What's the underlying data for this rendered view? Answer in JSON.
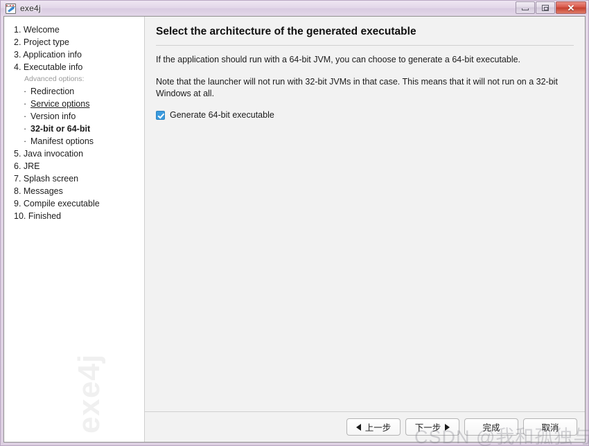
{
  "window": {
    "title": "exe4j",
    "icon": "exe4j-app-icon",
    "controls": {
      "minimize": "Minimize",
      "maximize": "Maximize",
      "close": "Close",
      "close_glyph": "✕"
    }
  },
  "sidebar": {
    "watermark": "exe4j",
    "group_label": "Advanced options:",
    "items": [
      {
        "label": "1. Welcome",
        "type": "step"
      },
      {
        "label": "2. Project type",
        "type": "step"
      },
      {
        "label": "3. Application info",
        "type": "step"
      },
      {
        "label": "4. Executable info",
        "type": "step"
      },
      {
        "label": "Redirection",
        "type": "sub",
        "style": "normal"
      },
      {
        "label": "Service options",
        "type": "sub",
        "style": "underline"
      },
      {
        "label": "Version info",
        "type": "sub",
        "style": "normal"
      },
      {
        "label": "32-bit or 64-bit",
        "type": "sub",
        "style": "bold"
      },
      {
        "label": "Manifest options",
        "type": "sub",
        "style": "normal"
      },
      {
        "label": "5. Java invocation",
        "type": "step"
      },
      {
        "label": "6. JRE",
        "type": "step"
      },
      {
        "label": "7. Splash screen",
        "type": "step"
      },
      {
        "label": "8. Messages",
        "type": "step"
      },
      {
        "label": "9. Compile executable",
        "type": "step"
      },
      {
        "label": "10. Finished",
        "type": "step"
      }
    ],
    "bullet": "·"
  },
  "main": {
    "title": "Select the architecture of the generated executable",
    "paragraph1": "If the application should run with a 64-bit JVM, you can choose to generate a 64-bit executable.",
    "paragraph2": "Note that the launcher will not run with 32-bit JVMs in that case. This means that it will not run on a 32-bit Windows at all.",
    "checkbox": {
      "label": "Generate 64-bit executable",
      "checked": "true"
    }
  },
  "footer": {
    "back_label": "上一步",
    "next_label": "下一步",
    "finish_label": "完成",
    "cancel_label": "取消"
  },
  "overlay": {
    "watermark": "CSDN @我和孤独与美酒"
  },
  "colors": {
    "accent": "#3a9ade",
    "frame": "#ddd0e2",
    "main_bg": "#f2f2f2",
    "close_button": "#c4402f"
  }
}
